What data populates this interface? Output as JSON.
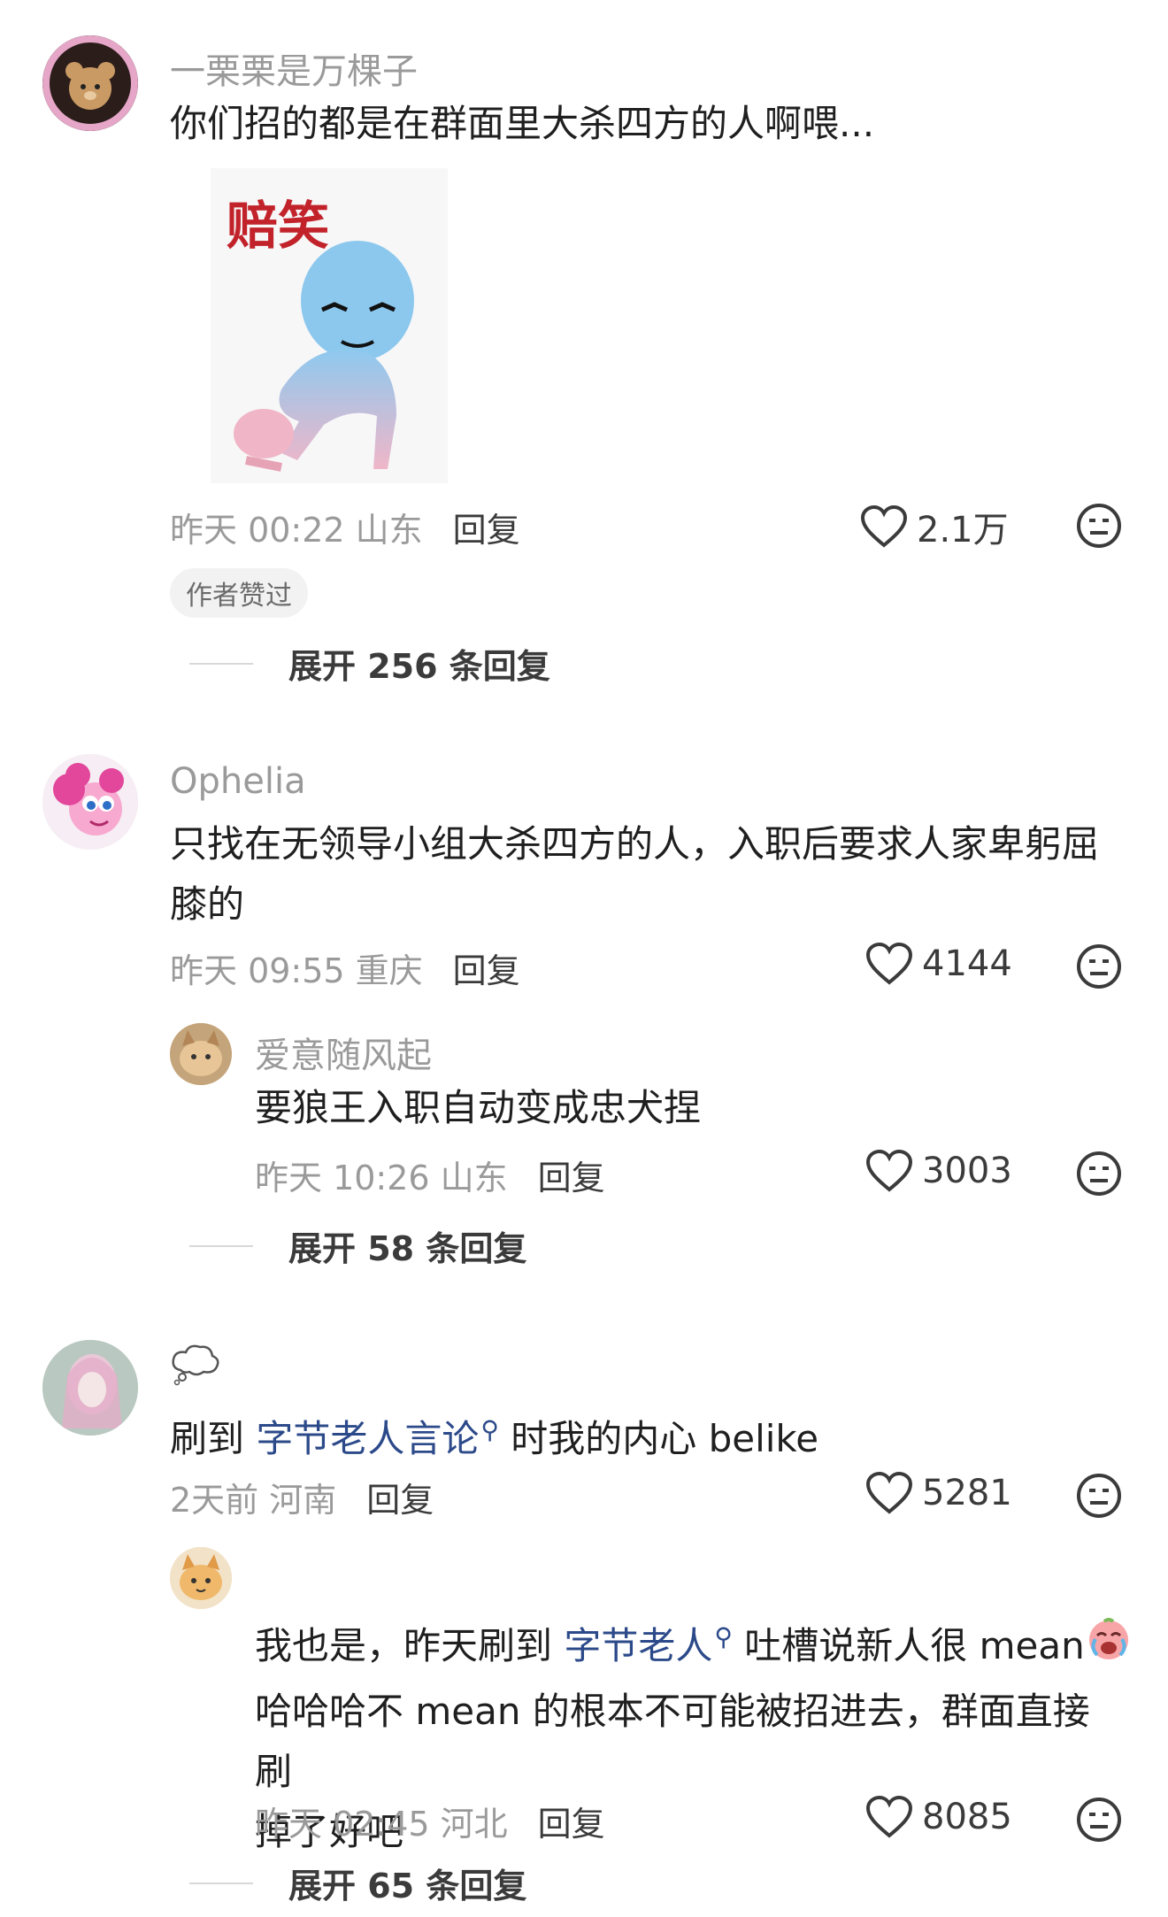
{
  "comments": [
    {
      "username": "一栗栗是万棵子",
      "text": "你们招的都是在群面里大杀四方的人啊喂...",
      "sticker_label": "赔笑",
      "time": "昨天 00:22 山东",
      "reply": "回复",
      "likes": "2.1万",
      "badge": "作者赞过",
      "expand": "展开 256 条回复"
    },
    {
      "username": "Ophelia",
      "text_line1": "只找在无领导小组大杀四方的人，入职后要求人家卑躬屈",
      "text_line2": "膝的",
      "time": "昨天 09:55 重庆",
      "reply": "回复",
      "likes": "4144",
      "sub_reply": {
        "username": "爱意随风起",
        "text": "要狼王入职自动变成忠犬捏",
        "time": "昨天 10:26 山东",
        "reply": "回复",
        "likes": "3003"
      },
      "expand": "展开 58 条回复"
    },
    {
      "username_icon": "cloud-icon",
      "text_pre": "刷到 ",
      "text_link": "字节老人言论",
      "text_post": " 时我的内心 belike",
      "time": "2天前 河南",
      "reply": "回复",
      "likes": "5281",
      "sub_reply": {
        "line1_pre": "我也是，昨天刷到 ",
        "line1_link": "字节老人",
        "line1_post": " 吐槽说新人很 mean",
        "line2": "哈哈哈不 mean 的根本不可能被招进去，群面直接刷",
        "line3": "掉了好吧",
        "time": "昨天 02:45 河北",
        "reply": "回复",
        "likes": "8085"
      },
      "expand": "展开 65 条回复"
    }
  ],
  "icons": {
    "like": "heart-outline-icon",
    "dislike": "meh-face-icon",
    "search": "search-icon"
  },
  "colors": {
    "link": "#2c4a8a",
    "meta": "#9a9a9a"
  }
}
